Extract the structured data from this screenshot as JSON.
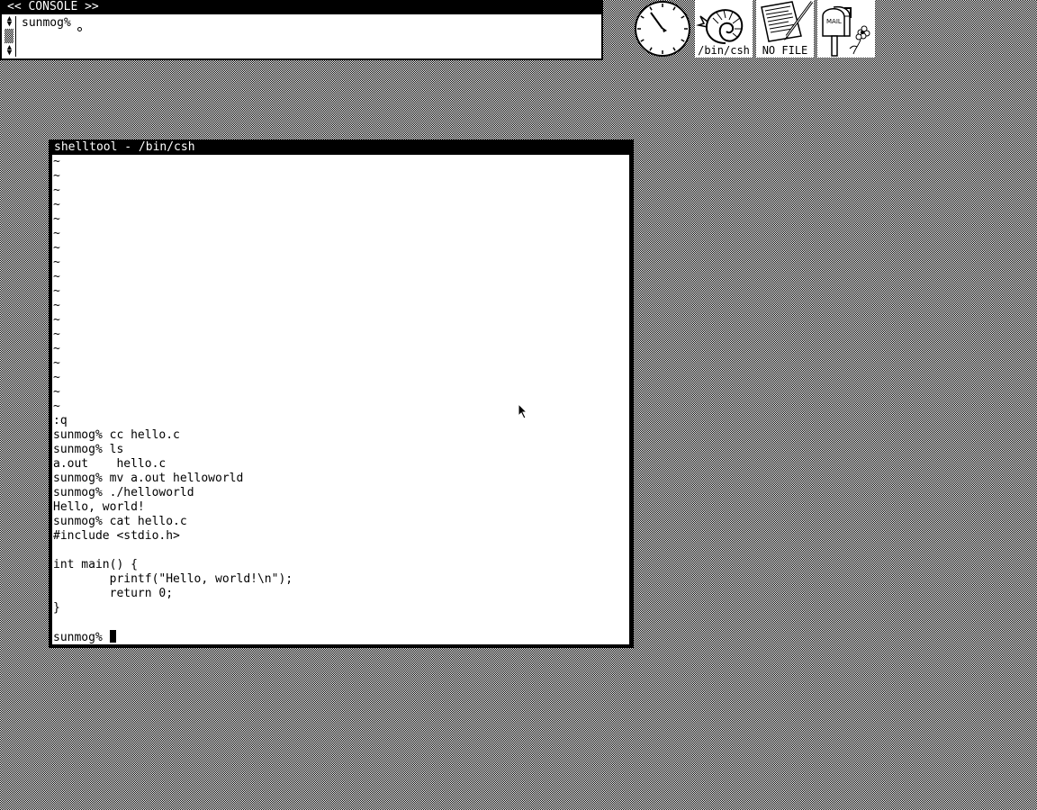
{
  "console": {
    "title": "<< CONSOLE >>",
    "lines": [
      "sunmog%"
    ]
  },
  "icons": {
    "clock": {
      "name": "clock-icon"
    },
    "shelltool": {
      "name": "nautilus-shell-icon",
      "label": "/bin/csh"
    },
    "textedit": {
      "name": "text-editor-icon",
      "label": "NO FILE"
    },
    "mailtool": {
      "name": "mailbox-icon",
      "sign": "MAIL"
    }
  },
  "shelltool": {
    "title": "shelltool - /bin/csh",
    "lines": [
      "~",
      "~",
      "~",
      "~",
      "~",
      "~",
      "~",
      "~",
      "~",
      "~",
      "~",
      "~",
      "~",
      "~",
      "~",
      "~",
      "~",
      "~",
      ":q",
      "sunmog% cc hello.c",
      "sunmog% ls",
      "a.out    hello.c",
      "sunmog% mv a.out helloworld",
      "sunmog% ./helloworld",
      "Hello, world!",
      "sunmog% cat hello.c",
      "#include <stdio.h>",
      "",
      "int main() {",
      "        printf(\"Hello, world!\\n\");",
      "        return 0;",
      "}",
      ""
    ],
    "prompt": "sunmog% "
  },
  "colors": {
    "foreground": "#000000",
    "background": "#ffffff"
  }
}
